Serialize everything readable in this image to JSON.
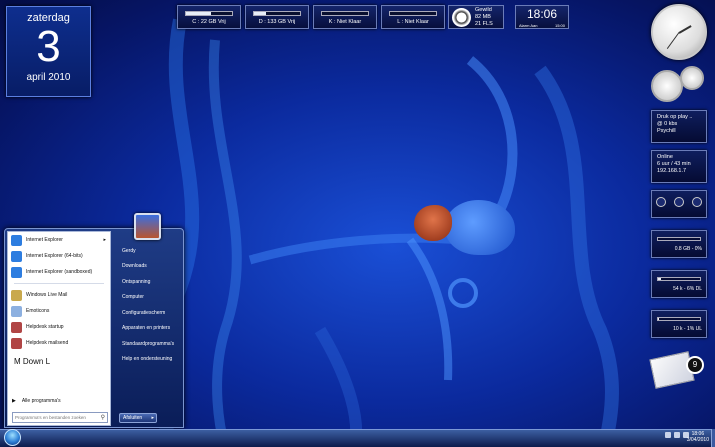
{
  "calendar": {
    "weekday": "zaterdag",
    "day": "3",
    "month_year": "april 2010"
  },
  "drives": [
    {
      "label": "C : 22 GB Vrij",
      "fill": 0.55
    },
    {
      "label": "D : 133 GB Vrij",
      "fill": 0.25
    },
    {
      "label": "K : Niet Klaar",
      "fill": 0
    },
    {
      "label": "L : Niet Klaar",
      "fill": 0
    }
  ],
  "network": {
    "line1": "Gewild",
    "line2": "82 MB",
    "line3": "21 FLS"
  },
  "clock": {
    "time": "18:06",
    "alarm": "Alarm Aan",
    "alarm_time": "15:00"
  },
  "media": {
    "line1": "Druk op play ..",
    "line2": "@ 0 kbs",
    "line3": "Psychill"
  },
  "online": {
    "line1": "Online",
    "line2": "6 uur / 43 min",
    "line3": "192.168.1.7"
  },
  "meters": [
    {
      "label": "0.8 GB - 0%",
      "fill": 0.0
    },
    {
      "label": "54 k - 6% DL",
      "fill": 0.06
    },
    {
      "label": "10 k - 1% UL",
      "fill": 0.01
    }
  ],
  "mail": {
    "count": "9"
  },
  "startmenu": {
    "programs": [
      {
        "label": "Internet Explorer",
        "icon": "ie-icon",
        "color": "#2d7de0",
        "submenu": true
      },
      {
        "label": "Internet Explorer (64-bits)",
        "icon": "ie-icon",
        "color": "#2d7de0",
        "submenu": false
      },
      {
        "label": "Internet Explorer (sandboxed)",
        "icon": "ie-icon",
        "color": "#2d7de0",
        "submenu": false
      },
      {
        "label": "Windows Live Mail",
        "icon": "mail-icon",
        "color": "#c9a94d",
        "submenu": false
      },
      {
        "label": "Emoticons",
        "icon": "search-icon",
        "color": "#8db0e0",
        "submenu": false
      },
      {
        "label": "Helpdesk startup",
        "icon": "helpdesk-icon",
        "color": "#b04545",
        "submenu": false
      },
      {
        "label": "Helpdesk mailsend",
        "icon": "helpdesk-icon",
        "color": "#b04545",
        "submenu": false
      }
    ],
    "recent_title": "M Down L",
    "all_programs": "Alle programma's",
    "search_placeholder": "Programma's en bestanden zoeken",
    "right_items": [
      "Gerdy",
      "Downloads",
      "Ontspanning",
      "Computer",
      "Configuratiescherm",
      "Apparaten en printers",
      "Standaardprogramma's",
      "Help en ondersteuning"
    ],
    "shutdown_label": "Afsluiten"
  },
  "taskbar": {
    "time": "18:06",
    "date": "3/04/2010"
  }
}
